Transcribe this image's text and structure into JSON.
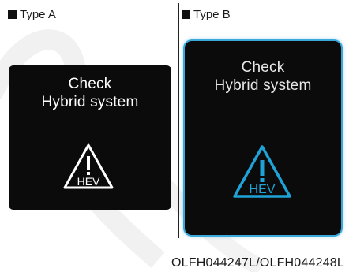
{
  "type_a": {
    "label": "Type A",
    "line1": "Check",
    "line2": "Hybrid system",
    "icon_text": "HEV",
    "icon_color": "#ffffff"
  },
  "type_b": {
    "label": "Type B",
    "line1": "Check",
    "line2": "Hybrid system",
    "icon_text": "HEV",
    "icon_color": "#1fa3d6",
    "border_color": "#3aa8d8"
  },
  "caption": "OLFH044247L/OLFH044248L",
  "icons": [
    "hev-warning-triangle-icon"
  ]
}
